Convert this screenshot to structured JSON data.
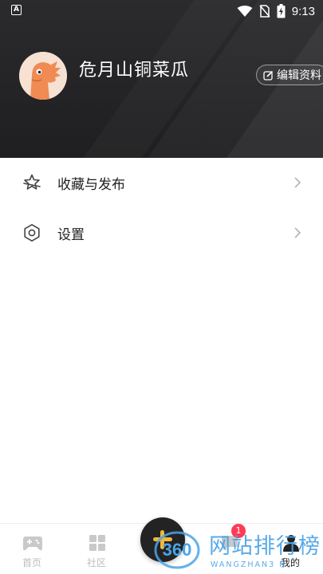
{
  "status_bar": {
    "time": "9:13",
    "left_icon_text": "A",
    "icons": [
      "app-a-icon",
      "wifi-icon",
      "no-sim-icon",
      "battery-charging-icon"
    ]
  },
  "profile": {
    "username": "危月山铜菜瓜",
    "edit_button_label": "编辑资料",
    "avatar_icon": "orange-dinosaur-avatar"
  },
  "menu": {
    "items": [
      {
        "label": "收藏与发布",
        "icon": "star-collection-icon"
      },
      {
        "label": "设置",
        "icon": "gear-icon"
      }
    ]
  },
  "bottom_nav": {
    "items": [
      {
        "label": "首页",
        "icon": "gamepad-icon",
        "active": false
      },
      {
        "label": "社区",
        "icon": "grid-icon",
        "active": false
      },
      {
        "label": "",
        "icon": "message-icon",
        "active": false,
        "badge": "1"
      },
      {
        "label": "我的",
        "icon": "person-icon",
        "active": true
      }
    ],
    "fab_icon": "plus-icon"
  },
  "watermark": {
    "logo_text": "360",
    "title": "网站排行榜",
    "subtitle": "WANGZHAN3 N"
  },
  "colors": {
    "header_bg": "#232325",
    "accent_yellow": "#f1b83b",
    "badge_red": "#ff3b55",
    "watermark_blue": "#4aa3e8",
    "avatar_orange": "#f08b53"
  }
}
